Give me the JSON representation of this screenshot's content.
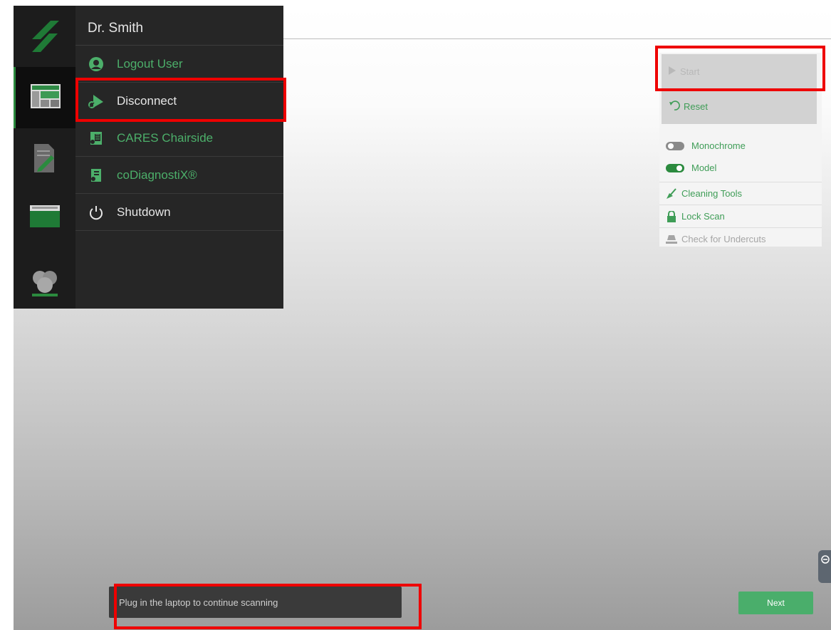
{
  "user": {
    "name": "Dr. Smith"
  },
  "menu": {
    "items": [
      {
        "label": "Logout User",
        "icon": "logout-user-icon"
      },
      {
        "label": "Disconnect",
        "icon": "disconnect-icon"
      },
      {
        "label": "CARES Chairside",
        "icon": "cares-chairside-icon"
      },
      {
        "label": "coDiagnostiX®",
        "icon": "codiagnostix-icon"
      },
      {
        "label": "Shutdown",
        "icon": "power-icon"
      }
    ]
  },
  "rail": {
    "items": [
      {
        "icon": "straumann-logo-icon"
      },
      {
        "icon": "scan-screen-icon",
        "active": true
      },
      {
        "icon": "notes-edit-icon"
      },
      {
        "icon": "folder-icon"
      },
      {
        "icon": "patients-icon"
      }
    ]
  },
  "panel": {
    "start_label": "Start",
    "reset_label": "Reset",
    "toggles": [
      {
        "label": "Monochrome",
        "on": false
      },
      {
        "label": "Model",
        "on": true
      }
    ],
    "links": [
      {
        "label": "Cleaning Tools",
        "enabled": true,
        "icon": "broom-icon"
      },
      {
        "label": "Lock Scan",
        "enabled": true,
        "icon": "lock-icon"
      },
      {
        "label": "Check for Undercuts",
        "enabled": false,
        "icon": "undercut-icon"
      }
    ]
  },
  "status": {
    "message": "Plug in the laptop to continue scanning"
  },
  "footer": {
    "next_label": "Next"
  },
  "colors": {
    "accent_green": "#4caf6a",
    "highlight_red": "#ee0000",
    "menu_bg": "#262626",
    "rail_bg": "#1c1c1c"
  }
}
